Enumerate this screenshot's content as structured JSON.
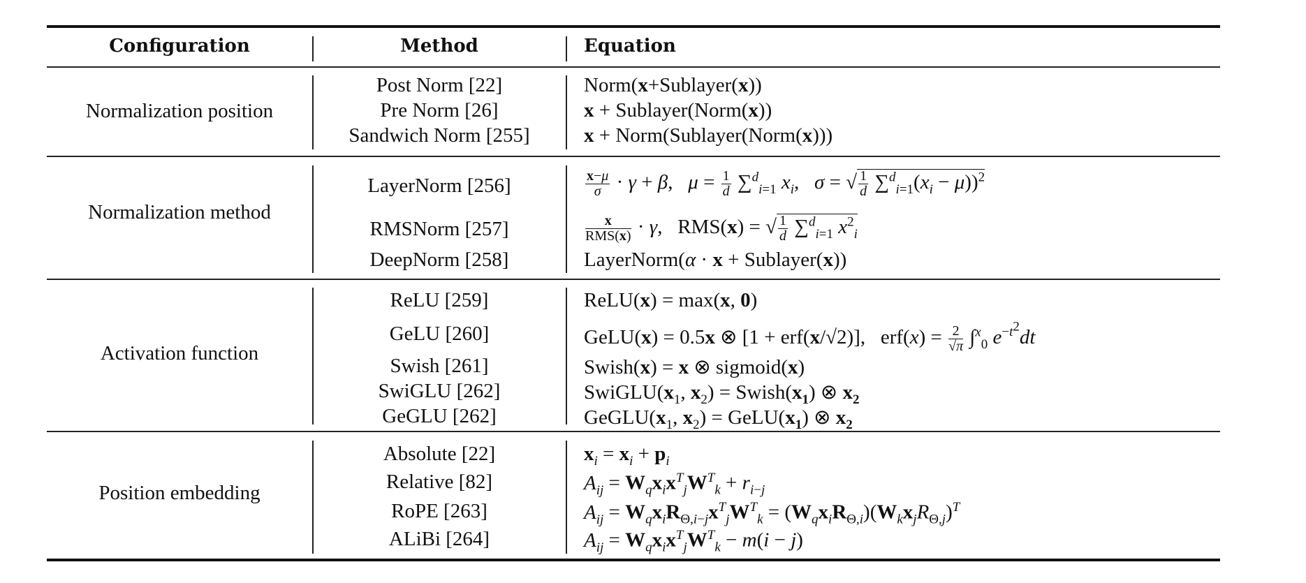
{
  "table": {
    "headers": {
      "configuration": "Configuration",
      "method": "Method",
      "equation": "Equation"
    },
    "groups": [
      {
        "configuration": "Normalization position",
        "rows": [
          {
            "method": "Post Norm [22]",
            "equation": "Norm(x+Sublayer(x))"
          },
          {
            "method": "Pre Norm [26]",
            "equation": "x + Sublayer(Norm(x))"
          },
          {
            "method": "Sandwich Norm [255]",
            "equation": "x + Norm(Sublayer(Norm(x)))"
          }
        ]
      },
      {
        "configuration": "Normalization method",
        "rows": [
          {
            "method": "LayerNorm [256]",
            "equation": "(x−μ)/σ · γ + β,   μ = 1/d Σ_{i=1}^{d} x_i,   σ = √(1/d Σ_{i=1}^{d} (x_i − μ))^2"
          },
          {
            "method": "RMSNorm [257]",
            "equation": "x/RMS(x) · γ,   RMS(x) = √(1/d Σ_{i=1}^{d} x_i^2)"
          },
          {
            "method": "DeepNorm [258]",
            "equation": "LayerNorm(α · x + Sublayer(x))"
          }
        ]
      },
      {
        "configuration": "Activation function",
        "rows": [
          {
            "method": "ReLU [259]",
            "equation": "ReLU(x) = max(x, 0)"
          },
          {
            "method": "GeLU [260]",
            "equation": "GeLU(x) = 0.5x ⊗ [1 + erf(x/√2)],   erf(x) = 2/√π ∫_0^x e^{−t^2} dt"
          },
          {
            "method": "Swish [261]",
            "equation": "Swish(x) = x ⊗ sigmoid(x)"
          },
          {
            "method": "SwiGLU [262]",
            "equation": "SwiGLU(x_1, x_2) = Swish(x_1) ⊗ x_2"
          },
          {
            "method": "GeGLU [262]",
            "equation": "GeGLU(x_1, x_2) = GeLU(x_1) ⊗ x_2"
          }
        ]
      },
      {
        "configuration": "Position embedding",
        "rows": [
          {
            "method": "Absolute [22]",
            "equation": "x_i = x_i + p_i"
          },
          {
            "method": "Relative [82]",
            "equation": "A_{ij} = W_q x_i x_j^T W_k^T + r_{i−j}"
          },
          {
            "method": "RoPE [263]",
            "equation": "A_{ij} = W_q x_i R_{Θ,i−j} x_j^T W_k^T = (W_q x_i R_{Θ,i})(W_k x_j R_{Θ,j})^T"
          },
          {
            "method": "ALiBi [264]",
            "equation": "A_{ij} = W_q x_i x_j^T W_k^T − m(i − j)"
          }
        ]
      }
    ]
  }
}
